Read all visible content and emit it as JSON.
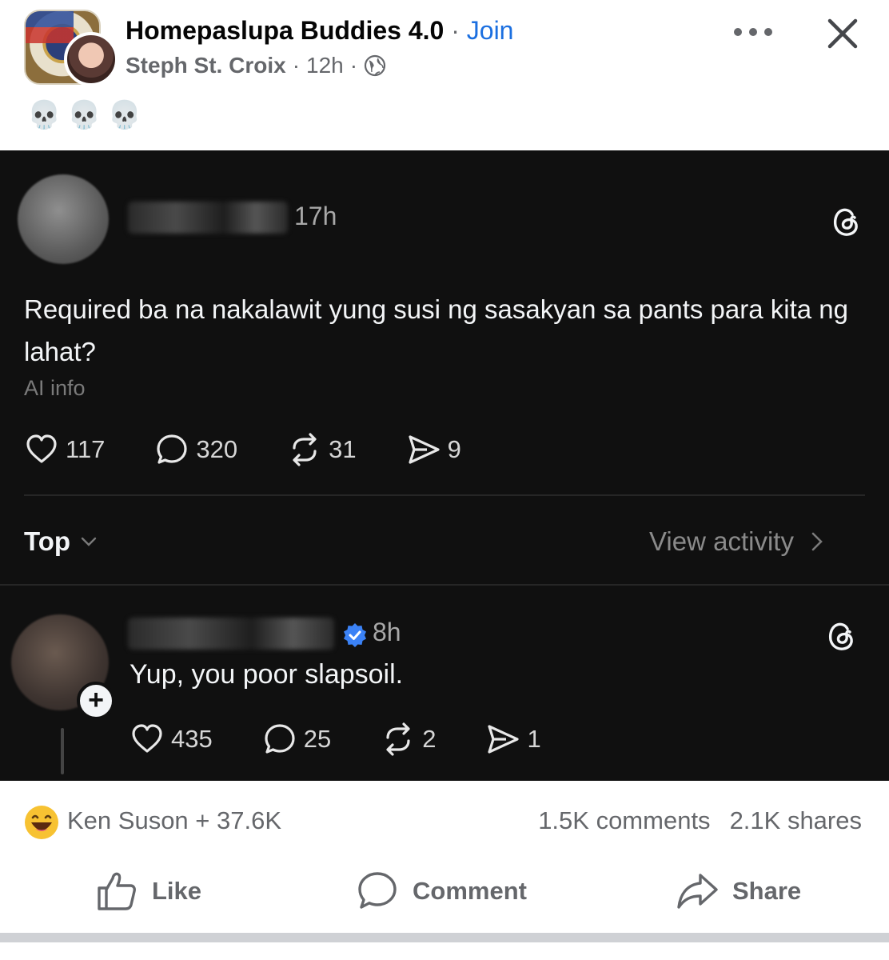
{
  "header": {
    "group_name": "Homepaslupa Buddies 4.0",
    "separator": "·",
    "join_label": "Join",
    "author": "Steph St. Croix",
    "time": "12h",
    "emoji_caption": "💀💀💀"
  },
  "threads_post": {
    "time": "17h",
    "body": "Required ba na  nakalawit yung susi ng sasakyan sa pants para kita ng lahat?",
    "ai_info": "AI info",
    "likes": "117",
    "replies": "320",
    "reposts": "31",
    "shares": "9",
    "sort_label": "Top",
    "view_activity": "View activity"
  },
  "threads_reply": {
    "time": "8h",
    "body": "Yup, you poor slapsoil.",
    "likes": "435",
    "replies": "25",
    "reposts": "2",
    "shares": "1",
    "follow_symbol": "+"
  },
  "footer": {
    "reactions": "Ken Suson + 37.6K",
    "comments": "1.5K comments",
    "shares": "2.1K shares",
    "like_label": "Like",
    "comment_label": "Comment",
    "share_label": "Share"
  },
  "colors": {
    "facebook_blue": "#1b6fe0",
    "threads_bg": "#101010",
    "meta_gray": "#65676b",
    "verified_blue": "#3b82f6"
  }
}
